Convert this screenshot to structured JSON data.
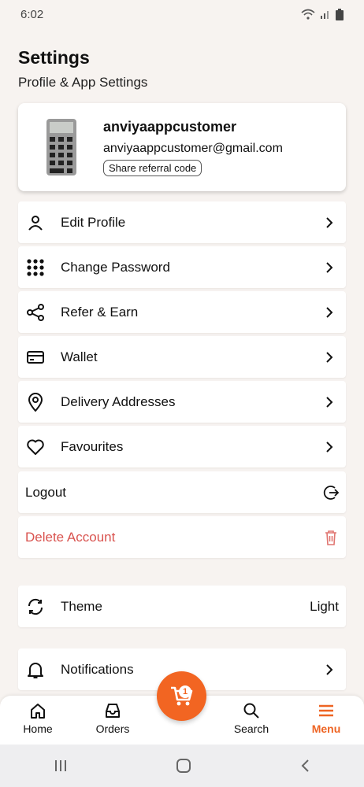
{
  "status_bar": {
    "time": "6:02"
  },
  "header": {
    "title": "Settings",
    "subtitle": "Profile & App Settings"
  },
  "profile": {
    "name": "anviyaappcustomer",
    "email": "anviyaappcustomer@gmail.com",
    "referral_label": "Share referral code"
  },
  "menu": {
    "edit_profile": "Edit Profile",
    "change_password": "Change Password",
    "refer_earn": "Refer & Earn",
    "wallet": "Wallet",
    "delivery_addresses": "Delivery Addresses",
    "favourites": "Favourites",
    "logout": "Logout",
    "delete_account": "Delete Account",
    "theme": "Theme",
    "theme_value": "Light",
    "notifications": "Notifications"
  },
  "bottom_nav": {
    "home": "Home",
    "orders": "Orders",
    "search": "Search",
    "menu": "Menu",
    "cart_count": "1"
  },
  "colors": {
    "accent": "#f26522",
    "danger": "#d9534f",
    "background": "#f7f3f0"
  }
}
